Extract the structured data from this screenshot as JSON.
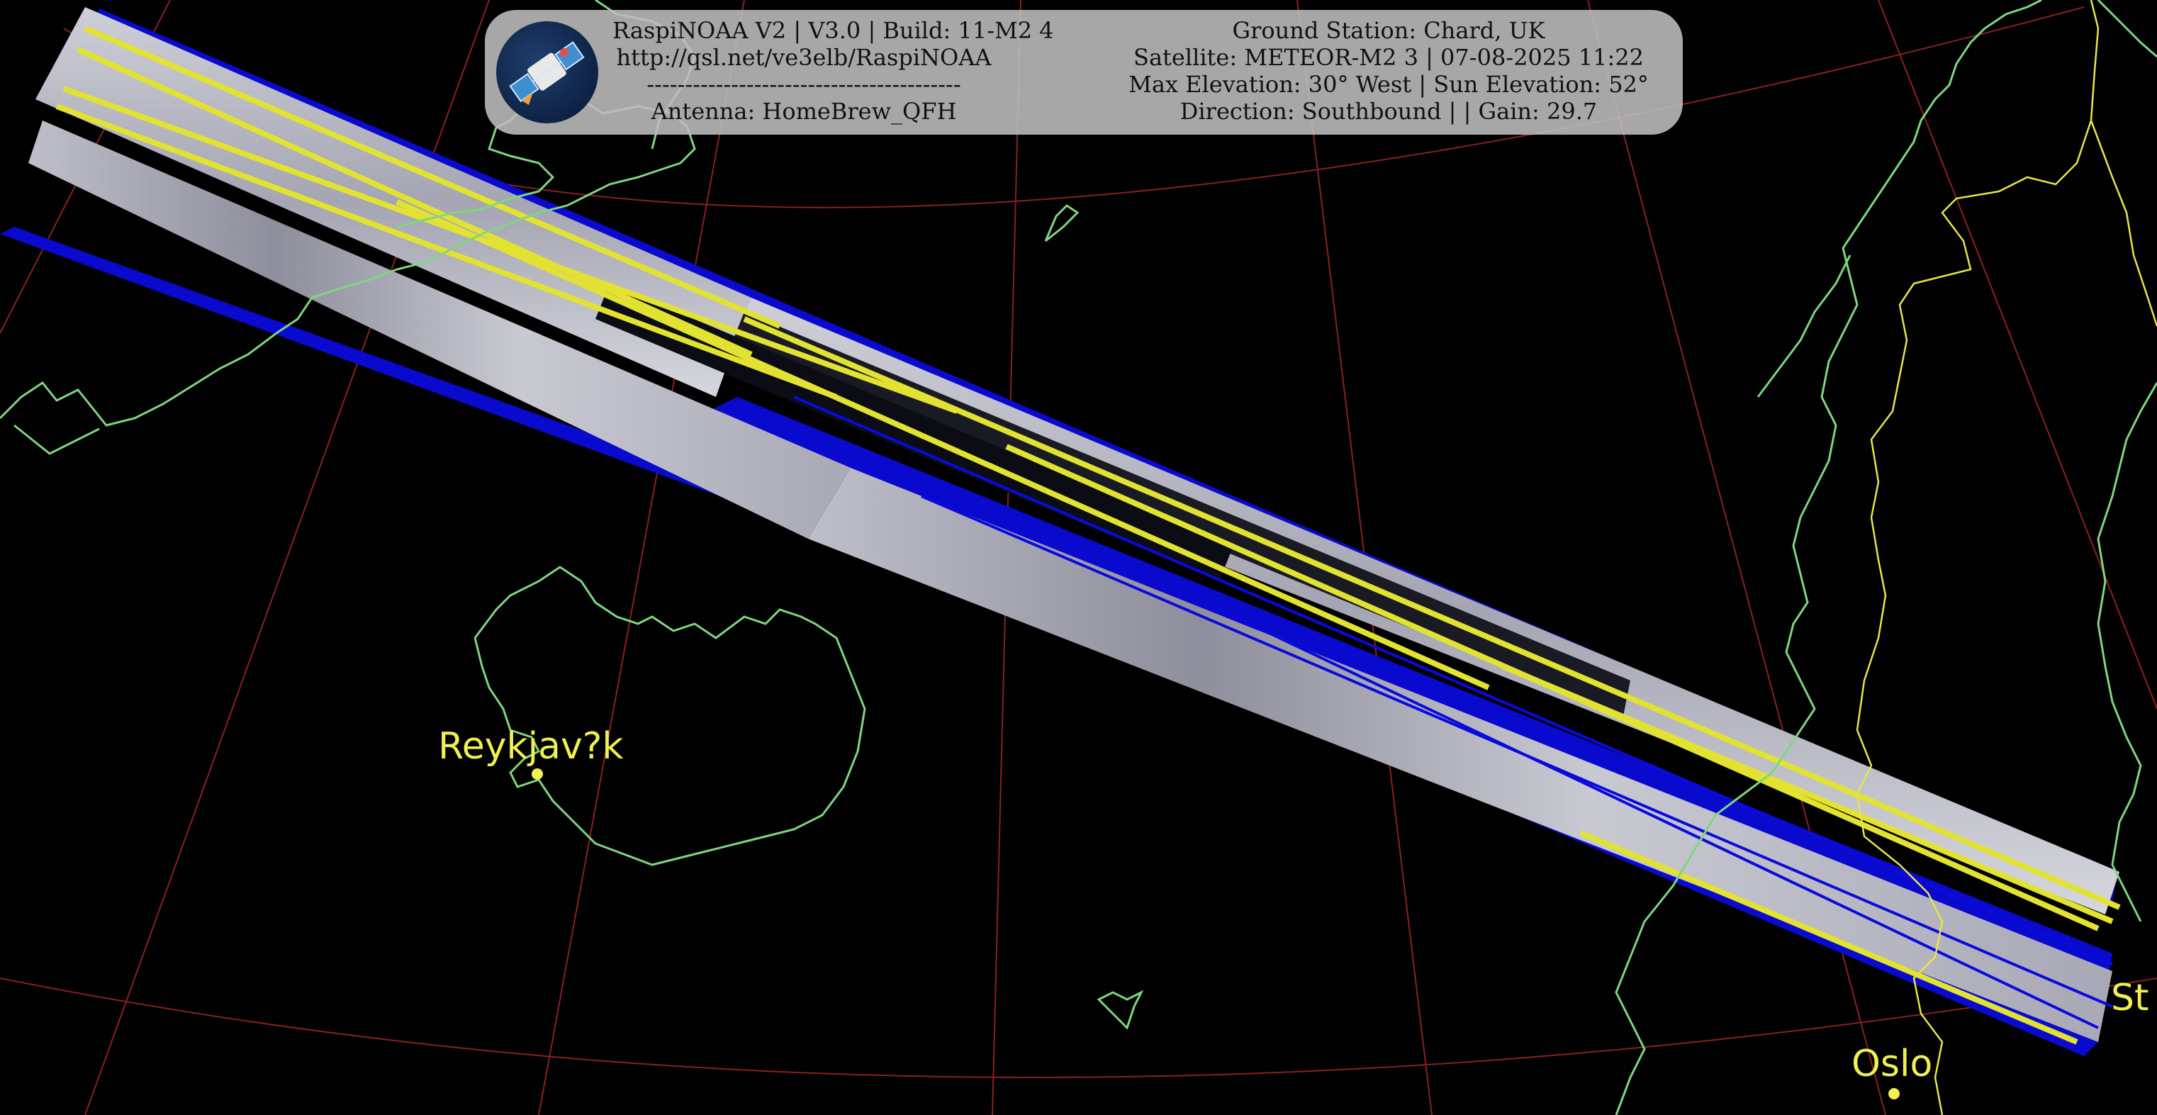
{
  "header": {
    "logo_icon": "satellite-icon",
    "left_lines": [
      "RaspiNOAA V2 | V3.0 | Build: 11-M2 4",
      "http://qsl.net/ve3elb/RaspiNOAA",
      "-----------------------------------------",
      "Antenna: HomeBrew_QFH"
    ],
    "right_lines": [
      "Ground Station: Chard, UK",
      "Satellite: METEOR-M2 3 | 07-08-2025 11:22",
      "Max Elevation: 30° West | Sun Elevation: 52°",
      "Direction: Southbound | | Gain: 29.7"
    ]
  },
  "map": {
    "cities": {
      "reykjavik": "Reykjav?k",
      "oslo": "Oslo",
      "stockholm_partial": "St"
    },
    "colors": {
      "background": "#000000",
      "coastline": "#7fd67f",
      "border": "#e6e64a",
      "graticule": "#8a2020",
      "city": "#f0f050",
      "swath_blue": "#0a0adc",
      "swath_yellow": "#e6e632"
    }
  }
}
